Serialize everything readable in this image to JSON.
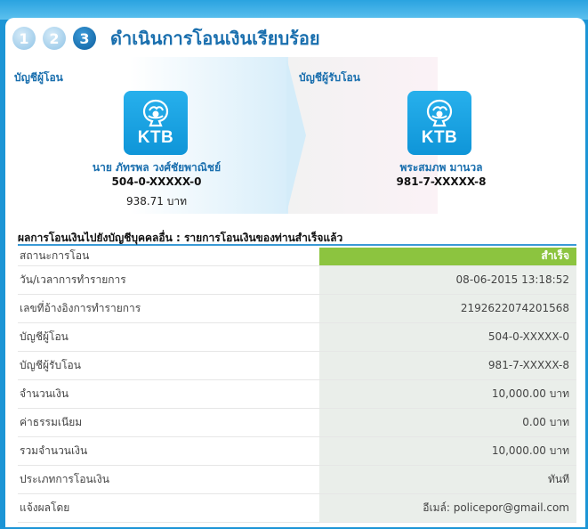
{
  "steps": [
    "1",
    "2",
    "3"
  ],
  "title": "ดำเนินการโอนเงินเรียบร้อย",
  "sender": {
    "label": "บัญชีผู้โอน",
    "bank": "KTB",
    "name": "นาย ภัทรพล วงศ์ชัยพาณิชย์",
    "account": "504-0-XXXXX-0",
    "balance": "938.71 บาท"
  },
  "receiver": {
    "label": "บัญชีผู้รับโอน",
    "bank": "KTB",
    "name": "พระสมภพ มานวล",
    "account": "981-7-XXXXX-8"
  },
  "result_heading": "ผลการโอนเงินไปยังบัญชีบุคคลอื่น : รายการโอนเงินของท่านสำเร็จแล้ว",
  "details": [
    {
      "label": "สถานะการโอน",
      "value": "สำเร็จ"
    },
    {
      "label": "วัน/เวลาการทำรายการ",
      "value": "08-06-2015 13:18:52"
    },
    {
      "label": "เลขที่อ้างอิงการทำรายการ",
      "value": "2192622074201568"
    },
    {
      "label": "บัญชีผู้โอน",
      "value": "504-0-XXXXX-0"
    },
    {
      "label": "บัญชีผู้รับโอน",
      "value": "981-7-XXXXX-8"
    },
    {
      "label": "จำนวนเงิน",
      "value": "10,000.00 บาท"
    },
    {
      "label": "ค่าธรรมเนียม",
      "value": "0.00 บาท"
    },
    {
      "label": "รวมจำนวนเงิน",
      "value": "10,000.00 บาท"
    },
    {
      "label": "ประเภทการโอนเงิน",
      "value": "ทันที"
    },
    {
      "label": "แจ้งผลโดย",
      "value": "อีเมล์: policepor@gmail.com"
    }
  ],
  "colors": {
    "accent": "#1a6fae",
    "success": "#8cc43f",
    "logo": "#1aa3e4"
  },
  "icons": [
    "ktb-logo-icon"
  ]
}
